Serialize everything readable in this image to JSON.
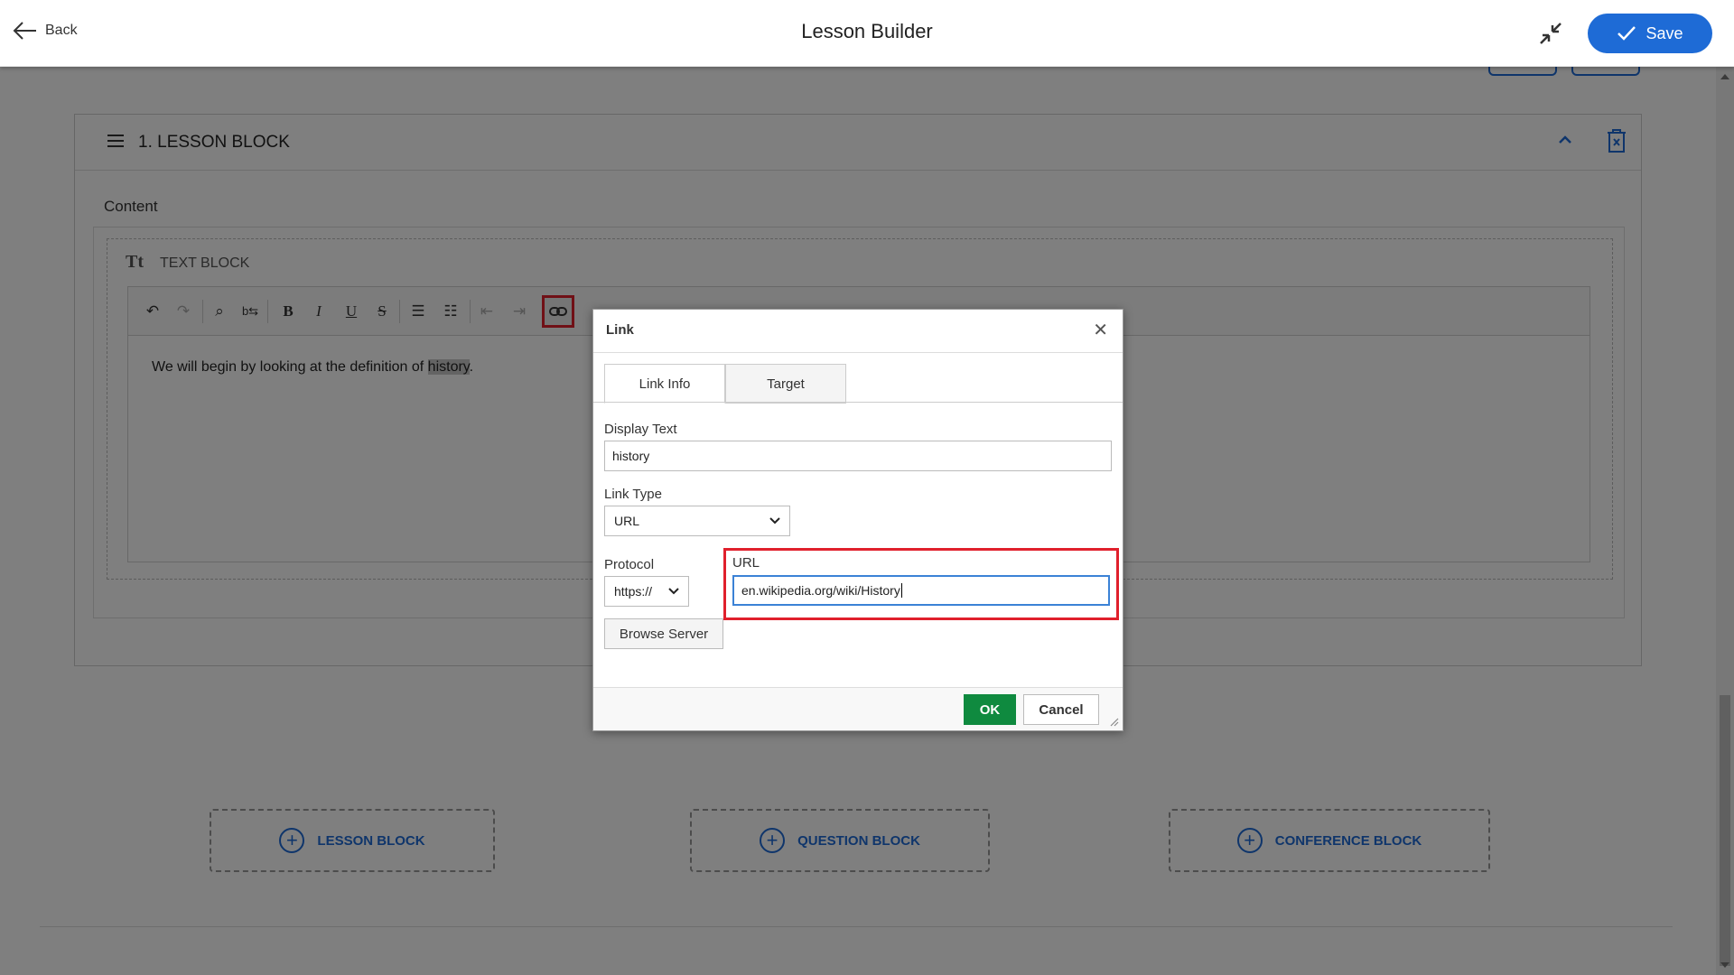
{
  "header": {
    "back_label": "Back",
    "title": "Lesson Builder",
    "save_label": "Save"
  },
  "lesson_block": {
    "title": "1. LESSON BLOCK",
    "content_label": "Content",
    "text_block_icon": "Tt",
    "text_block_label": "TEXT BLOCK",
    "editor_text_before": "We will begin by looking at the definition of ",
    "editor_text_selected": "history",
    "editor_text_after": "."
  },
  "add_buttons": [
    {
      "label": "LESSON BLOCK"
    },
    {
      "label": "QUESTION BLOCK"
    },
    {
      "label": "CONFERENCE BLOCK"
    }
  ],
  "dialog": {
    "title": "Link",
    "tabs": [
      {
        "label": "Link Info"
      },
      {
        "label": "Target"
      }
    ],
    "display_text_label": "Display Text",
    "display_text_value": "history",
    "link_type_label": "Link Type",
    "link_type_value": "URL",
    "protocol_label": "Protocol",
    "protocol_value": "https://",
    "url_label": "URL",
    "url_value": "en.wikipedia.org/wiki/History",
    "browse_label": "Browse Server",
    "ok_label": "OK",
    "cancel_label": "Cancel"
  },
  "colors": {
    "accent": "#1e6bd6",
    "highlight": "#e0202c",
    "ok": "#0f8a3f"
  }
}
